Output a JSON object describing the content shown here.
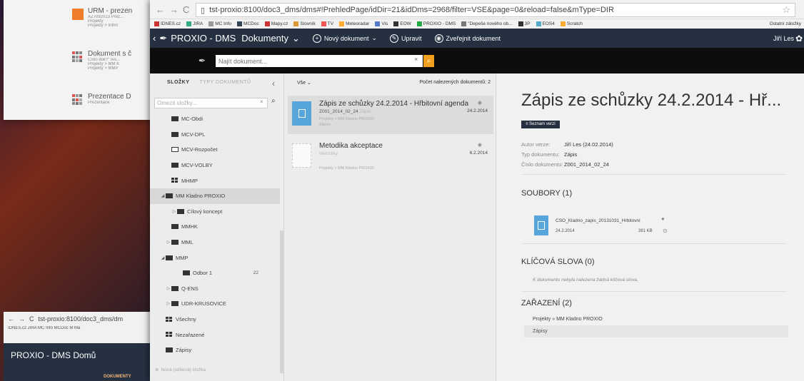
{
  "bg_card": {
    "items": [
      {
        "title": "URM - prezen",
        "sub": "AZ7092013 Prez...",
        "sub2": "Projekty",
        "sub3": "Projekty > Infrm"
      },
      {
        "title": "Dokument s č",
        "sub": "Číslo dok?\"Tes...",
        "sub2": "Projekty > MM K",
        "sub3": "Projekty > MMP"
      },
      {
        "title": "Prezentace D",
        "sub": "Prezentace"
      }
    ]
  },
  "bg_win2": {
    "url": "tst-proxio:8100/doc3_dms/dm",
    "bookmarks": "IDNES.cz  JIRA  MC Info  MCDoc  M Ma",
    "brand": "PROXIO - DMS  Domů",
    "dok": "DOKUMENTY"
  },
  "browser": {
    "url": "tst-proxio:8100/doc3_dms/dms#!PrehledPage/idDir=21&idDms=2968/filter=VSE&page=0&reload=false&mType=DIR",
    "bookmarks": [
      "IDNES.cz",
      "JIRA",
      "MC Info",
      "MCDoc",
      "Mapy.cz",
      "Slovník",
      "TV",
      "Meteoradar",
      "Vis",
      "EOW",
      "PROXIO - DMS",
      "\"Depeše nového ob...",
      "3P",
      "EOS4",
      "Scratch"
    ],
    "other_bookmarks": "Ostatní záložky"
  },
  "app_nav": {
    "brand": "PROXIO - DMS",
    "section": "Dokumenty",
    "new_doc": "Nový dokument",
    "edit": "Upravit",
    "publish": "Zveřejnit dokument",
    "user": "Jiří Les"
  },
  "search": {
    "placeholder": "Najít dokument..."
  },
  "folders": {
    "tab_active": "SLOŽKY",
    "tab_inactive": "TYPY DOKUMENTŮ",
    "filter_placeholder": "Omezit složky...",
    "tree": [
      {
        "label": "MC-Obdi",
        "indent": 1,
        "icon": "fold",
        "arrow": ""
      },
      {
        "label": "MCV-DPL",
        "indent": 1,
        "icon": "fold",
        "arrow": ""
      },
      {
        "label": "MCV-Rozpočet",
        "indent": 1,
        "icon": "empty",
        "arrow": ""
      },
      {
        "label": "MCV-VOLBY",
        "indent": 1,
        "icon": "fold",
        "arrow": ""
      },
      {
        "label": "MHMP",
        "indent": 1,
        "icon": "grid",
        "arrow": ""
      },
      {
        "label": "MM Kladno PROXIO",
        "indent": 0,
        "icon": "open",
        "arrow": "◢",
        "selected": true
      },
      {
        "label": "Cílový koncept",
        "indent": 2,
        "icon": "fold",
        "arrow": "▷"
      },
      {
        "label": "MMHK",
        "indent": 1,
        "icon": "fold",
        "arrow": ""
      },
      {
        "label": "MML",
        "indent": 1,
        "icon": "fold",
        "arrow": "▷"
      },
      {
        "label": "MMP",
        "indent": 0,
        "icon": "open",
        "arrow": "◢"
      },
      {
        "label": "Odbor 1",
        "indent": 3,
        "icon": "fold",
        "arrow": "",
        "count": "22"
      },
      {
        "label": "Q-ENS",
        "indent": 1,
        "icon": "fold",
        "arrow": "▷"
      },
      {
        "label": "UDR-KRUSOVICE",
        "indent": 1,
        "icon": "fold",
        "arrow": "▷"
      },
      {
        "label": "Všechny",
        "indent": 0,
        "icon": "grid",
        "arrow": ""
      },
      {
        "label": "Nezařazené",
        "indent": 0,
        "icon": "grid",
        "arrow": ""
      },
      {
        "label": "Zápisy",
        "indent": 0,
        "icon": "fold",
        "arrow": ""
      }
    ],
    "new_folder": "Nová (sdílená) složka"
  },
  "doclist": {
    "filter": "Vše",
    "count_label": "Počet nalezených dokumentů: 2",
    "docs": [
      {
        "title": "Zápis ze schůzky 24.2.2014 - Hřbitovní agenda",
        "number": "Z001_2014_02_24",
        "type": "Zápis",
        "path": "Projekty > MM Kladno PROXIO",
        "tag": "Zápisy",
        "date": "24.2.2014"
      },
      {
        "title": "Metodika akceptace",
        "number": "",
        "type": "Metodiky",
        "path": "Projekty > MM Kladno PROXIO",
        "tag": "",
        "date": "6.2.2014"
      }
    ]
  },
  "detail": {
    "title": "Zápis ze schůzky 24.2.2014 - Hř...",
    "versions_btn": "Seznam verzí",
    "props": [
      {
        "k": "Autor verze:",
        "v": "Jiří Les (24.02.2014)"
      },
      {
        "k": "Typ dokumentu:",
        "v": "Zápis"
      },
      {
        "k": "Číslo dokumentu:",
        "v": "Z001_2014_02_24"
      }
    ],
    "files_head": "SOUBORY (1)",
    "file": {
      "name": "CSO_Kladno_zapis_20131031_Hrbitovni",
      "date": "24.2.2014",
      "size": "381 KB"
    },
    "keywords_head": "KLÍČOVÁ SLOVA (0)",
    "no_keywords": "K dokumentu nebyla nalezena žádná klíčová slova.",
    "zarazeni_head": "ZAŘAZENÍ (2)",
    "zarazeni_path": "Projekty  »  MM Kladno PROXIO",
    "zarazeni_tag": "Zápisy"
  }
}
